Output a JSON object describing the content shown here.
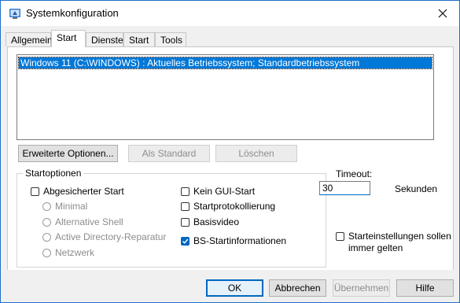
{
  "window": {
    "title": "Systemkonfiguration",
    "icon": "msconfig-icon"
  },
  "tabs": [
    {
      "label": "Allgemein",
      "active": false
    },
    {
      "label": "Start",
      "active": true
    },
    {
      "label": "Dienste",
      "active": false
    },
    {
      "label": "Start",
      "active": false
    },
    {
      "label": "Tools",
      "active": false
    }
  ],
  "boot_list": {
    "items": [
      "Windows 11 (C:\\WINDOWS) : Aktuelles Betriebssystem; Standardbetriebssystem"
    ],
    "selected_index": 0
  },
  "boot_buttons": {
    "advanced": "Erweiterte Optionen...",
    "set_default": "Als Standard",
    "delete": "Löschen"
  },
  "boot_options": {
    "title": "Startoptionen",
    "safe_boot": {
      "label": "Abgesicherter Start",
      "checked": false
    },
    "radios": [
      {
        "label": "Minimal",
        "enabled": false
      },
      {
        "label": "Alternative Shell",
        "enabled": false
      },
      {
        "label": "Active Directory-Reparatur",
        "enabled": false
      },
      {
        "label": "Netzwerk",
        "enabled": false
      }
    ],
    "no_gui": {
      "label": "Kein GUI-Start",
      "checked": false
    },
    "boot_log": {
      "label": "Startprotokollierung",
      "checked": false
    },
    "base_video": {
      "label": "Basisvideo",
      "checked": false
    },
    "os_info": {
      "label": "BS-Startinformationen",
      "checked": true
    }
  },
  "timeout": {
    "label": "Timeout:",
    "value": "30",
    "unit": "Sekunden"
  },
  "persist": {
    "label_line1": "Starteinstellungen sollen",
    "label_line2": "immer gelten",
    "checked": false
  },
  "dialog_buttons": {
    "ok": "OK",
    "cancel": "Abbrechen",
    "apply": "Übernehmen",
    "help": "Hilfe"
  },
  "colors": {
    "accent": "#0067c0",
    "selection": "#0078d7",
    "border": "#1f6fc9"
  }
}
